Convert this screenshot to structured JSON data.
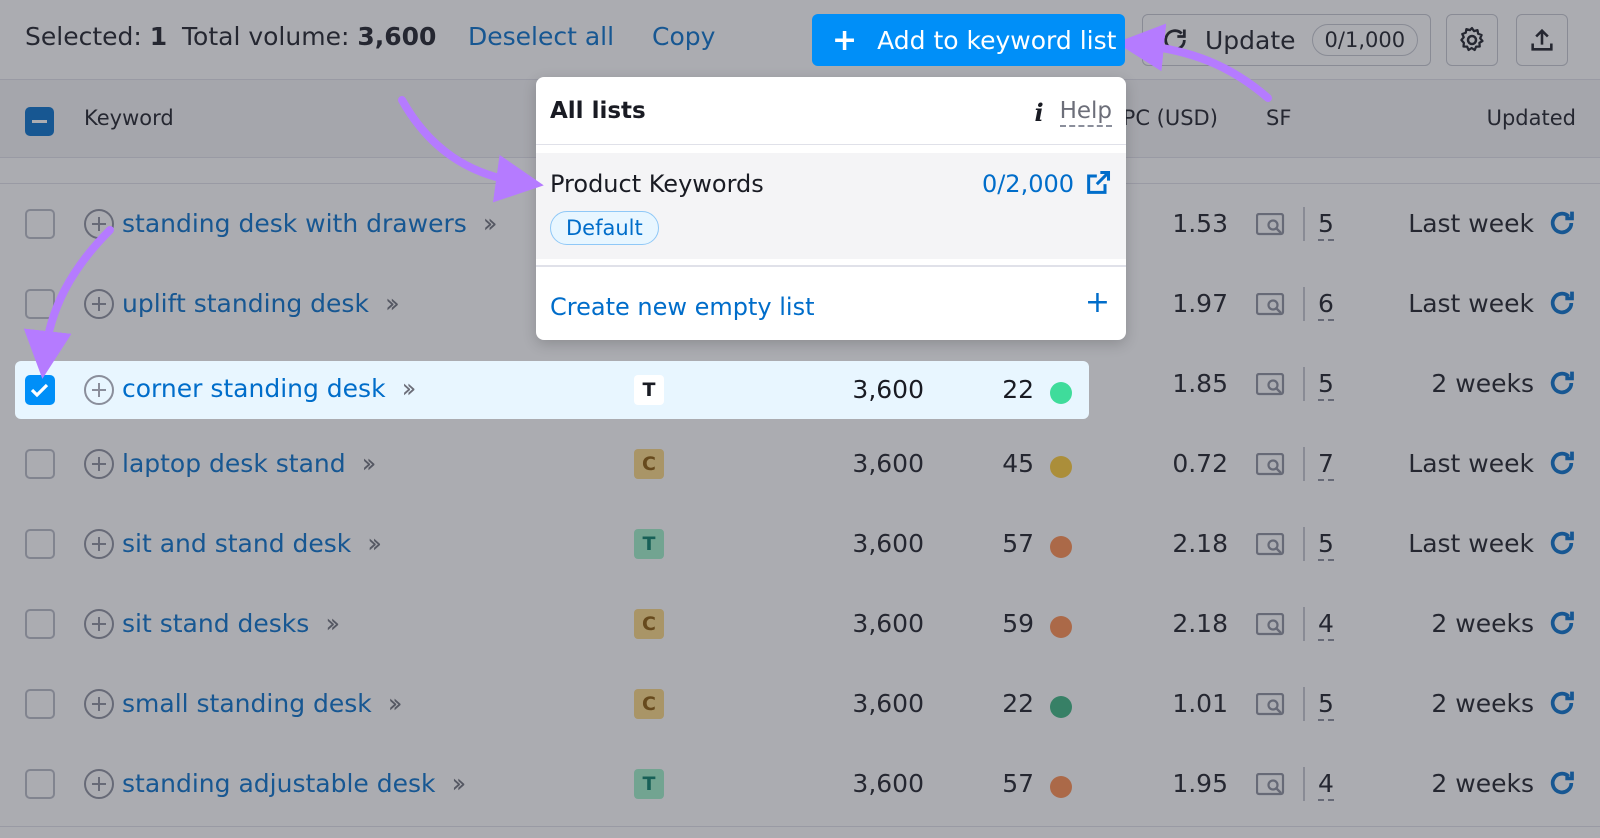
{
  "toolbar": {
    "selected_label": "Selected:",
    "selected_count": "1",
    "total_volume_label": "Total volume:",
    "total_volume_value": "3,600",
    "deselect_all": "Deselect all",
    "copy": "Copy",
    "add_to_list": "Add to keyword list",
    "update": "Update",
    "update_count": "0/1,000"
  },
  "table": {
    "headers": {
      "keyword": "Keyword",
      "cpc": "CPC (USD)",
      "sf": "SF",
      "updated": "Updated"
    },
    "rows": [
      {
        "keyword": "standing desk with drawers",
        "intent": "",
        "volume": "",
        "kd": "",
        "kd_color": "",
        "cpc": "1.53",
        "sf": "5",
        "updated": "Last week"
      },
      {
        "keyword": "uplift standing desk",
        "intent": "",
        "volume": "",
        "kd": "",
        "kd_color": "",
        "cpc": "1.97",
        "sf": "6",
        "updated": "Last week"
      },
      {
        "keyword": "corner standing desk",
        "intent": "T",
        "volume": "3,600",
        "kd": "22",
        "kd_color": "#3fdc9b",
        "cpc": "1.85",
        "sf": "5",
        "updated": "2 weeks"
      },
      {
        "keyword": "laptop desk stand",
        "intent": "C",
        "volume": "3,600",
        "kd": "45",
        "kd_color": "#ffcc33",
        "cpc": "0.72",
        "sf": "7",
        "updated": "Last week"
      },
      {
        "keyword": "sit and stand desk",
        "intent": "T",
        "volume": "3,600",
        "kd": "57",
        "kd_color": "#ff8c4b",
        "cpc": "2.18",
        "sf": "5",
        "updated": "Last week"
      },
      {
        "keyword": "sit stand desks",
        "intent": "C",
        "volume": "3,600",
        "kd": "59",
        "kd_color": "#ff8c4b",
        "cpc": "2.18",
        "sf": "4",
        "updated": "2 weeks"
      },
      {
        "keyword": "small standing desk",
        "intent": "C",
        "volume": "3,600",
        "kd": "22",
        "kd_color": "#37b47f",
        "cpc": "1.01",
        "sf": "5",
        "updated": "2 weeks"
      },
      {
        "keyword": "standing adjustable desk",
        "intent": "T",
        "volume": "3,600",
        "kd": "57",
        "kd_color": "#ff8c4b",
        "cpc": "1.95",
        "sf": "4",
        "updated": "2 weeks"
      }
    ]
  },
  "dropdown": {
    "title": "All lists",
    "help": "Help",
    "list_name": "Product Keywords",
    "list_count": "0/2,000",
    "badge": "Default",
    "create": "Create new empty list"
  },
  "colors": {
    "accent": "#008ff8",
    "link": "#006dca",
    "arrow": "#b57bff"
  }
}
